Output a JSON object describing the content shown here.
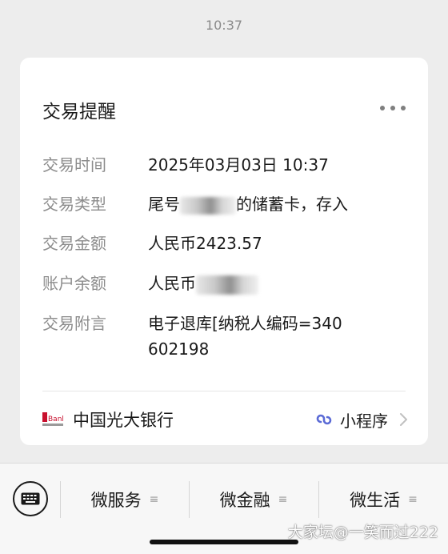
{
  "chat": {
    "time": "10:37"
  },
  "card": {
    "title": "交易提醒",
    "more_icon": "more-dots-icon",
    "rows": [
      {
        "label": "交易时间",
        "value": "2025年03月03日  10:37"
      },
      {
        "label": "交易类型",
        "value_prefix": "尾号",
        "value_suffix": "的储蓄卡，存入"
      },
      {
        "label": "交易金额",
        "value": "人民币2423.57"
      },
      {
        "label": "账户余额",
        "value_prefix": "人民币"
      },
      {
        "label": "交易附言",
        "value": "电子退库[纳税人编码=340602198"
      }
    ],
    "footer": {
      "bank_name": "中国光大银行",
      "bank_logo_text": "Bank",
      "mini_program_label": "小程序",
      "mini_program_icon": "mini-program-icon",
      "chevron_icon": "chevron-right-icon"
    }
  },
  "bottom_menu": {
    "keyboard_icon": "keyboard-icon",
    "items": [
      {
        "label": "微服务",
        "icon": "≡"
      },
      {
        "label": "微金融",
        "icon": "≡"
      },
      {
        "label": "微生活",
        "icon": "≡"
      }
    ]
  },
  "watermark": "大家坛@一笑而过222",
  "colors": {
    "background": "#ededed",
    "card": "#ffffff",
    "label_gray": "#8c8c8c",
    "text": "#1a1a1a",
    "bank_red": "#c8102e",
    "mini_program_blue": "#5b6bd6"
  }
}
